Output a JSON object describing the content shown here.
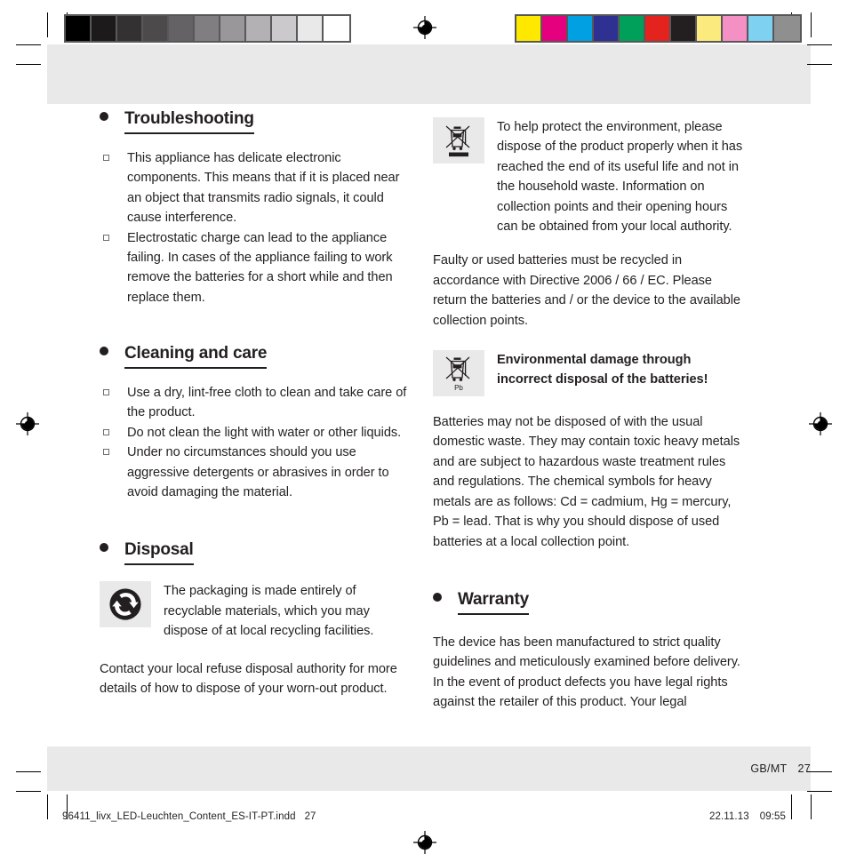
{
  "document": {
    "footer": {
      "locale": "GB/MT",
      "page_number": "27"
    },
    "print_slug": {
      "filename": "96411_livx_LED-Leuchten_Content_ES-IT-PT.indd",
      "page_number": "27",
      "date": "22.11.13",
      "time": "09:55"
    },
    "calibration": {
      "grayscale_label": "grayscale-calibration-strip",
      "grayscale_patches": [
        "#000000",
        "#1c1a1b",
        "#333132",
        "#4c4a4b",
        "#646264",
        "#807e80",
        "#999799",
        "#b3b1b3",
        "#cbc9cb",
        "#e9e9e9",
        "#ffffff"
      ],
      "color_label": "color-calibration-strip",
      "color_patches": [
        "#ffe800",
        "#e5007e",
        "#00a0e3",
        "#2e3192",
        "#00a05a",
        "#e4231f",
        "#231f20",
        "#fbeb7f",
        "#f490c4",
        "#7fd1f1",
        "#8f8f8f"
      ]
    }
  },
  "left_column": {
    "troubleshooting": {
      "heading": "Troubleshooting",
      "items": [
        "This appliance has delicate electronic components. This means that if it is placed near an object that transmits radio signals, it could cause interference.",
        "Electrostatic charge can lead to the appliance failing. In cases of the appliance failing to work remove the batteries for a short while and then replace them."
      ]
    },
    "cleaning": {
      "heading": "Cleaning and care",
      "items": [
        "Use a dry, lint-free cloth to clean and take care of the product.",
        "Do not clean the light with water or other liquids.",
        "Under no circumstances should you use aggressive detergents or abrasives in order to avoid damaging the material."
      ]
    },
    "disposal": {
      "heading": "Disposal",
      "recycling_icon": "green-dot-recycling-icon",
      "recycling_text": "The packaging is made entirely of recyclable materials, which you may dispose of at local recycling facilities.",
      "paragraph": "Contact your local refuse disposal authority for more details of how to dispose of your worn-out product."
    }
  },
  "right_column": {
    "weee": {
      "icon": "crossed-out-wheelie-bin-icon",
      "text": "To help protect the environment, please dispose of the product properly when it has reached the end of its useful life and not in the household waste. Information on collection points and their opening hours can be obtained from your local authority."
    },
    "batteries_directive": "Faulty or used batteries must be recycled in accordance with Directive 2006 / 66 / EC. Please return the batteries and / or the device to the available collection points.",
    "battery_warning": {
      "icon": "crossed-out-bin-pb-icon",
      "icon_label": "Pb",
      "text": "Environmental damage through incorrect disposal of the batteries!"
    },
    "heavy_metals": "Batteries may not be disposed of with the usual domestic waste. They may contain toxic heavy metals and are subject to hazardous waste treatment rules and regulations. The chemical symbols for heavy metals are as follows: Cd = cadmium, Hg = mercury, Pb = lead. That is why you should dispose of used batteries at a local collection point.",
    "warranty": {
      "heading": "Warranty",
      "paragraph": "The device has been manufactured to strict quality guidelines and meticulously examined before delivery. In the event of product defects you have legal rights against the retailer of this product. Your legal"
    }
  }
}
